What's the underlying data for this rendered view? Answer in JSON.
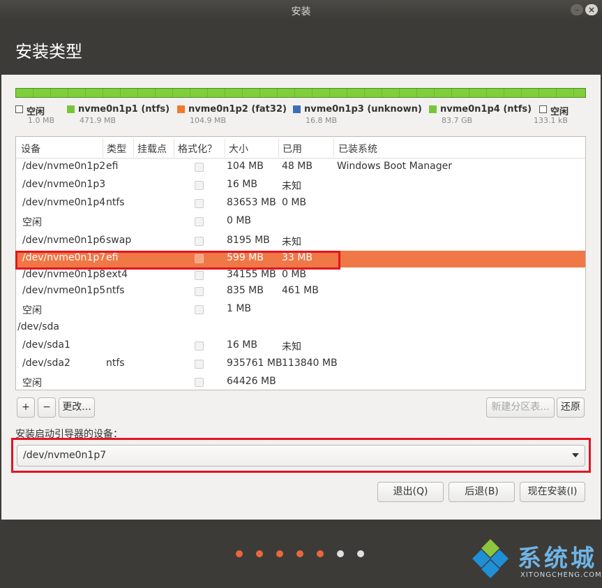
{
  "window": {
    "title": "安装",
    "minimize_glyph": "–",
    "close_glyph": "×"
  },
  "page": {
    "title": "安装类型"
  },
  "legend": [
    {
      "name": "空闲",
      "size": "1.0 MB",
      "color": "#ffffff"
    },
    {
      "name": "nvme0n1p1 (ntfs)",
      "size": "471.9 MB",
      "color": "#77c63a"
    },
    {
      "name": "nvme0n1p2 (fat32)",
      "size": "104.9 MB",
      "color": "#f07a2a"
    },
    {
      "name": "nvme0n1p3 (unknown)",
      "size": "16.8 MB",
      "color": "#3e6fb6"
    },
    {
      "name": "nvme0n1p4 (ntfs)",
      "size": "83.7 GB",
      "color": "#77c63a"
    },
    {
      "name": "空闲",
      "size": "133.1 kB",
      "color": "#ffffff"
    }
  ],
  "table": {
    "headers": [
      "设备",
      "类型",
      "挂载点",
      "格式化？",
      "大小",
      "已用",
      "已装系统"
    ],
    "rows": [
      {
        "device": "/dev/nvme0n1p2",
        "type": "efi",
        "mount": "",
        "size": "104 MB",
        "used": "48 MB",
        "system": "Windows Boot Manager",
        "check": true
      },
      {
        "device": "/dev/nvme0n1p3",
        "type": "",
        "mount": "",
        "size": "16 MB",
        "used": "未知",
        "system": "",
        "check": true
      },
      {
        "device": "/dev/nvme0n1p4",
        "type": "ntfs",
        "mount": "",
        "size": "83653 MB",
        "used": "0 MB",
        "system": "",
        "check": true
      },
      {
        "device": "空闲",
        "type": "",
        "mount": "",
        "size": "0 MB",
        "used": "",
        "system": "",
        "check": true
      },
      {
        "device": "/dev/nvme0n1p6",
        "type": "swap",
        "mount": "",
        "size": "8195 MB",
        "used": "未知",
        "system": "",
        "check": true
      },
      {
        "device": "/dev/nvme0n1p7",
        "type": "efi",
        "mount": "",
        "size": "599 MB",
        "used": "33 MB",
        "system": "",
        "check": true,
        "selected": true
      },
      {
        "device": "/dev/nvme0n1p8",
        "type": "ext4",
        "mount": "",
        "size": "34155 MB",
        "used": "0 MB",
        "system": "",
        "check": true
      },
      {
        "device": "/dev/nvme0n1p5",
        "type": "ntfs",
        "mount": "",
        "size": "835 MB",
        "used": "461 MB",
        "system": "",
        "check": true
      },
      {
        "device": "空闲",
        "type": "",
        "mount": "",
        "size": "1 MB",
        "used": "",
        "system": "",
        "check": true
      },
      {
        "device": "/dev/sda",
        "type": "",
        "mount": "",
        "size": "",
        "used": "",
        "system": "",
        "check": false,
        "group": true
      },
      {
        "device": "/dev/sda1",
        "type": "",
        "mount": "",
        "size": "16 MB",
        "used": "未知",
        "system": "",
        "check": true
      },
      {
        "device": "/dev/sda2",
        "type": "ntfs",
        "mount": "",
        "size": "935761 MB",
        "used": "113840 MB",
        "system": "",
        "check": true
      },
      {
        "device": "空闲",
        "type": "",
        "mount": "",
        "size": "64426 MB",
        "used": "",
        "system": "",
        "check": true
      }
    ]
  },
  "partition_buttons": {
    "add": "+",
    "remove": "−",
    "change": "更改...",
    "new_table": "新建分区表...",
    "revert": "还原"
  },
  "boot_loader": {
    "label": "安装启动引导器的设备：",
    "value": "/dev/nvme0n1p7"
  },
  "actions": {
    "quit": "退出(Q)",
    "back": "后退(B)",
    "install_now": "现在安装(I)"
  },
  "progress_dots": {
    "total": 7,
    "completed": 5,
    "active_color": "#e9673d",
    "inactive_color": "#e0e0e0"
  },
  "watermark": {
    "text": "系统城",
    "sub": "XITONGCHENG.COM"
  }
}
